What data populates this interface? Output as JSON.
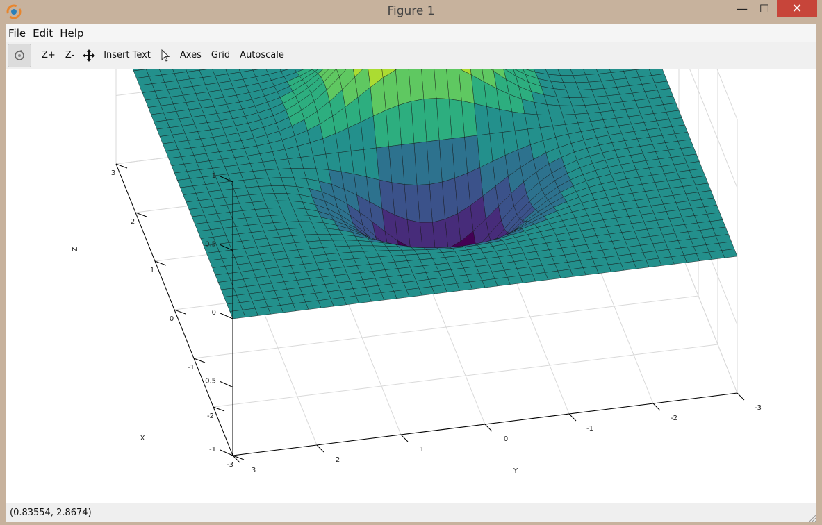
{
  "window": {
    "title": "Figure 1",
    "controls": {
      "minimize": "—",
      "maximize": "☐",
      "close": "✕"
    }
  },
  "menubar": [
    {
      "key": "F",
      "rest": "ile"
    },
    {
      "key": "E",
      "rest": "dit"
    },
    {
      "key": "H",
      "rest": "elp"
    }
  ],
  "toolbar": {
    "zoom_in": "Z+",
    "zoom_out": "Z-",
    "insert_text": "Insert Text",
    "axes": "Axes",
    "grid": "Grid",
    "autoscale": "Autoscale"
  },
  "status": {
    "coords": "(0.83554, 2.8674)"
  },
  "colors": {
    "close_button": "#c7453a",
    "grid": "#d9d9d9",
    "colormap": "viridis"
  },
  "chart_data": {
    "type": "surface",
    "xlabel": "X",
    "ylabel": "Y",
    "zlabel": "Z",
    "xlim": [
      -3,
      3
    ],
    "ylim": [
      -3,
      3
    ],
    "zlim": [
      -1,
      1
    ],
    "x_ticks": [
      "-3",
      "-2",
      "-1",
      "0",
      "1",
      "2",
      "3"
    ],
    "y_ticks": [
      "3",
      "2",
      "1",
      "0",
      "-1",
      "-2",
      "-3"
    ],
    "z_ticks": [
      "-1",
      "-0.5",
      "0",
      "0.5",
      "1"
    ],
    "grid": true,
    "colormap": "viridis",
    "surface": "z = x·exp(-x² - y²) scaled so peak ≈ 0.75, trough ≈ -0.75; peak near y≈0, x≈+1; trough near y≈0, x≈-1"
  }
}
